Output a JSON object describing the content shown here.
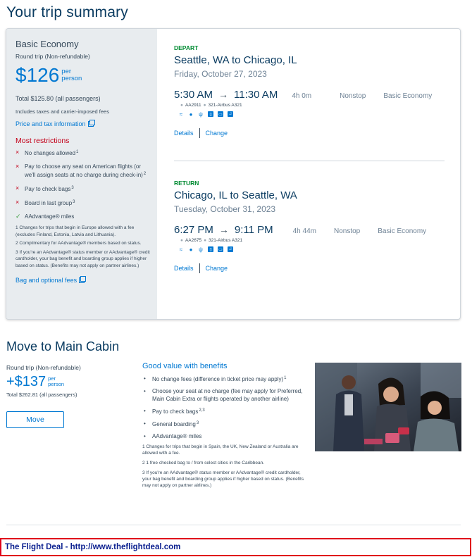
{
  "page": {
    "title": "Your trip summary"
  },
  "fare": {
    "name": "Basic Economy",
    "trip_type": "Round trip (Non-refundable)",
    "price": "$126",
    "per_1": "per",
    "per_2": "person",
    "total": "Total $125.80 (all passengers)",
    "includes": "Includes taxes and carrier-imposed fees",
    "price_tax_link": "Price and tax information",
    "restrictions_title": "Most restrictions",
    "restrictions": [
      {
        "mark": "×",
        "text": "No changes allowed",
        "sup": "1"
      },
      {
        "mark": "×",
        "text": "Pay to choose any seat on American flights (or we'll assign seats at no charge during check-in)",
        "sup": "2"
      },
      {
        "mark": "×",
        "text": "Pay to check bags",
        "sup": "3"
      },
      {
        "mark": "×",
        "text": "Board in last group",
        "sup": "3"
      },
      {
        "mark": "✓",
        "text": "AAdvantage® miles",
        "sup": ""
      }
    ],
    "footnotes": [
      "1 Changes for trips that begin in Europe allowed with a fee (excludes Finland, Estonia, Latvia and Lithuania).",
      "2 Complimentary for AAdvantage® members based on status.",
      "3 If you're an AAdvantage® status member or AAdvantage® credit cardholder, your bag benefit and boarding group applies if higher based on status. (Benefits may not apply on partner airlines.)"
    ],
    "bag_link": "Bag and optional fees"
  },
  "depart": {
    "label": "DEPART",
    "route": "Seattle, WA to Chicago, IL",
    "date": "Friday, October 27, 2023",
    "dep_time": "5:30 AM",
    "arr_time": "11:30 AM",
    "duration": "4h 0m",
    "stops": "Nonstop",
    "cabin": "Basic Economy",
    "flight": "AA2911",
    "aircraft": "321-Airbus A321",
    "details": "Details",
    "change": "Change"
  },
  "return": {
    "label": "RETURN",
    "route": "Chicago, IL to Seattle, WA",
    "date": "Tuesday, October 31, 2023",
    "dep_time": "6:27 PM",
    "arr_time": "9:11 PM",
    "duration": "4h 44m",
    "stops": "Nonstop",
    "cabin": "Basic Economy",
    "flight": "AA2675",
    "aircraft": "321-Airbus A321",
    "details": "Details",
    "change": "Change"
  },
  "amenity_icons": [
    "wifi-icon",
    "power-icon",
    "usb-icon",
    "phone-entertainment-icon",
    "tv-icon",
    "app-icon"
  ],
  "upgrade": {
    "title": "Move to Main Cabin",
    "trip_type": "Round trip (Non-refundable)",
    "price": "+$137",
    "per_1": "per",
    "per_2": "person",
    "total": "Total $262.81 (all passengers)",
    "button": "Move",
    "benefits_title": "Good value with benefits",
    "benefits": [
      {
        "text": "No change fees (difference in ticket price may apply)",
        "sup": "1"
      },
      {
        "text": "Choose your seat at no charge (fee may apply for Preferred, Main Cabin Extra or flights operated by another airline)",
        "sup": ""
      },
      {
        "text": "Pay to check bags",
        "sup": "2,3"
      },
      {
        "text": "General boarding",
        "sup": "3"
      },
      {
        "text": "AAdvantage® miles",
        "sup": ""
      }
    ],
    "footnotes": [
      "1 Changes for trips that begin in Spain, the UK, New Zealand or Australia are allowed with a fee.",
      "2 1 free checked bag to / from select cities in the Caribbean.",
      "3 If you're an AAdvantage® status member or AAdvantage® credit cardholder, your bag benefit and boarding group applies if higher based on status. (Benefits may not apply on partner airlines.)"
    ]
  },
  "watermark": {
    "text": "The Flight Deal - http://www.theflightdeal.com"
  },
  "colors": {
    "brand_blue": "#0078d2",
    "navy": "#0b3c61",
    "restriction_red": "#c30019",
    "depart_green": "#008b32"
  }
}
